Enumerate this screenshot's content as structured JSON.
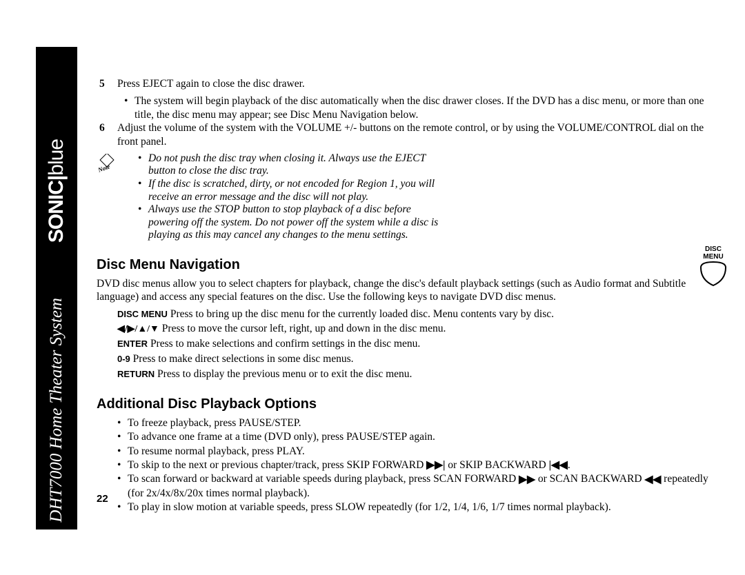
{
  "brand": {
    "sonic": "SONIC",
    "blue": "blue"
  },
  "model": "DHT7000 Home Theater System",
  "steps": {
    "s5": {
      "num": "5",
      "text": "Press EJECT again to close the disc drawer.",
      "sub": "The system will begin playback of the disc automatically when the disc drawer closes. If the DVD has a disc menu, or more than one title, the disc menu may appear; see Disc Menu Navigation below."
    },
    "s6": {
      "num": "6",
      "text": "Adjust the volume of the system with the VOLUME +/- buttons on the remote control, or by using the VOLUME/CONTROL dial on the front panel."
    }
  },
  "notes": {
    "n1": "Do not push the disc tray when closing it. Always use the EJECT button to close the disc tray.",
    "n2": "If the disc is scratched, dirty, or not encoded for Region 1, you will receive an error message and the disc will not play.",
    "n3": "Always use the STOP button to stop playback of a disc before powering off the system. Do not power off the system while a disc is playing as this may cancel any changes to the menu settings."
  },
  "sectionA": {
    "title": "Disc Menu Navigation",
    "intro": "DVD disc menus allow you to select chapters for playback, change the disc's default playback settings (such as Audio format and Subtitle language) and access any special features on the disc. Use the following keys to navigate DVD disc menus.",
    "keys": {
      "discmenu": {
        "label": "DISC MENU",
        "desc": "   Press to bring up the disc menu for the currently loaded disc. Menu contents vary by disc."
      },
      "arrows": {
        "label": "◀/▶/▲/▼",
        "desc": "     Press to move the cursor left, right, up and down in the disc menu."
      },
      "enter": {
        "label": "ENTER",
        "desc": "   Press to make selections and confirm settings in the disc menu."
      },
      "digits": {
        "label": "0-9",
        "desc": "   Press to make direct selections in some disc menus."
      },
      "return": {
        "label": "RETURN",
        "desc": "   Press to display the previous menu or to exit the disc menu."
      }
    },
    "iconLabel": "DISC MENU"
  },
  "sectionB": {
    "title": "Additional Disc Playback Options",
    "items": {
      "o1": "To freeze playback, press PAUSE/STEP.",
      "o2": "To advance one frame at a time (DVD only), press PAUSE/STEP again.",
      "o3": "To resume normal playback, press PLAY.",
      "o4a": "To skip to the next or previous chapter/track, press SKIP FORWARD ",
      "o4b": " or SKIP BACKWARD ",
      "o4c": ".",
      "o5a": "To scan forward or backward at variable speeds during playback, press SCAN FORWARD ",
      "o5b": " or SCAN BACKWARD ",
      "o5c": " repeatedly (for 2x/4x/8x/20x times normal playback).",
      "o6": "To play in slow motion at variable speeds, press SLOW repeatedly (for 1/2, 1/4, 1/6, 1/7 times normal playback)."
    }
  },
  "pageNum": "22"
}
